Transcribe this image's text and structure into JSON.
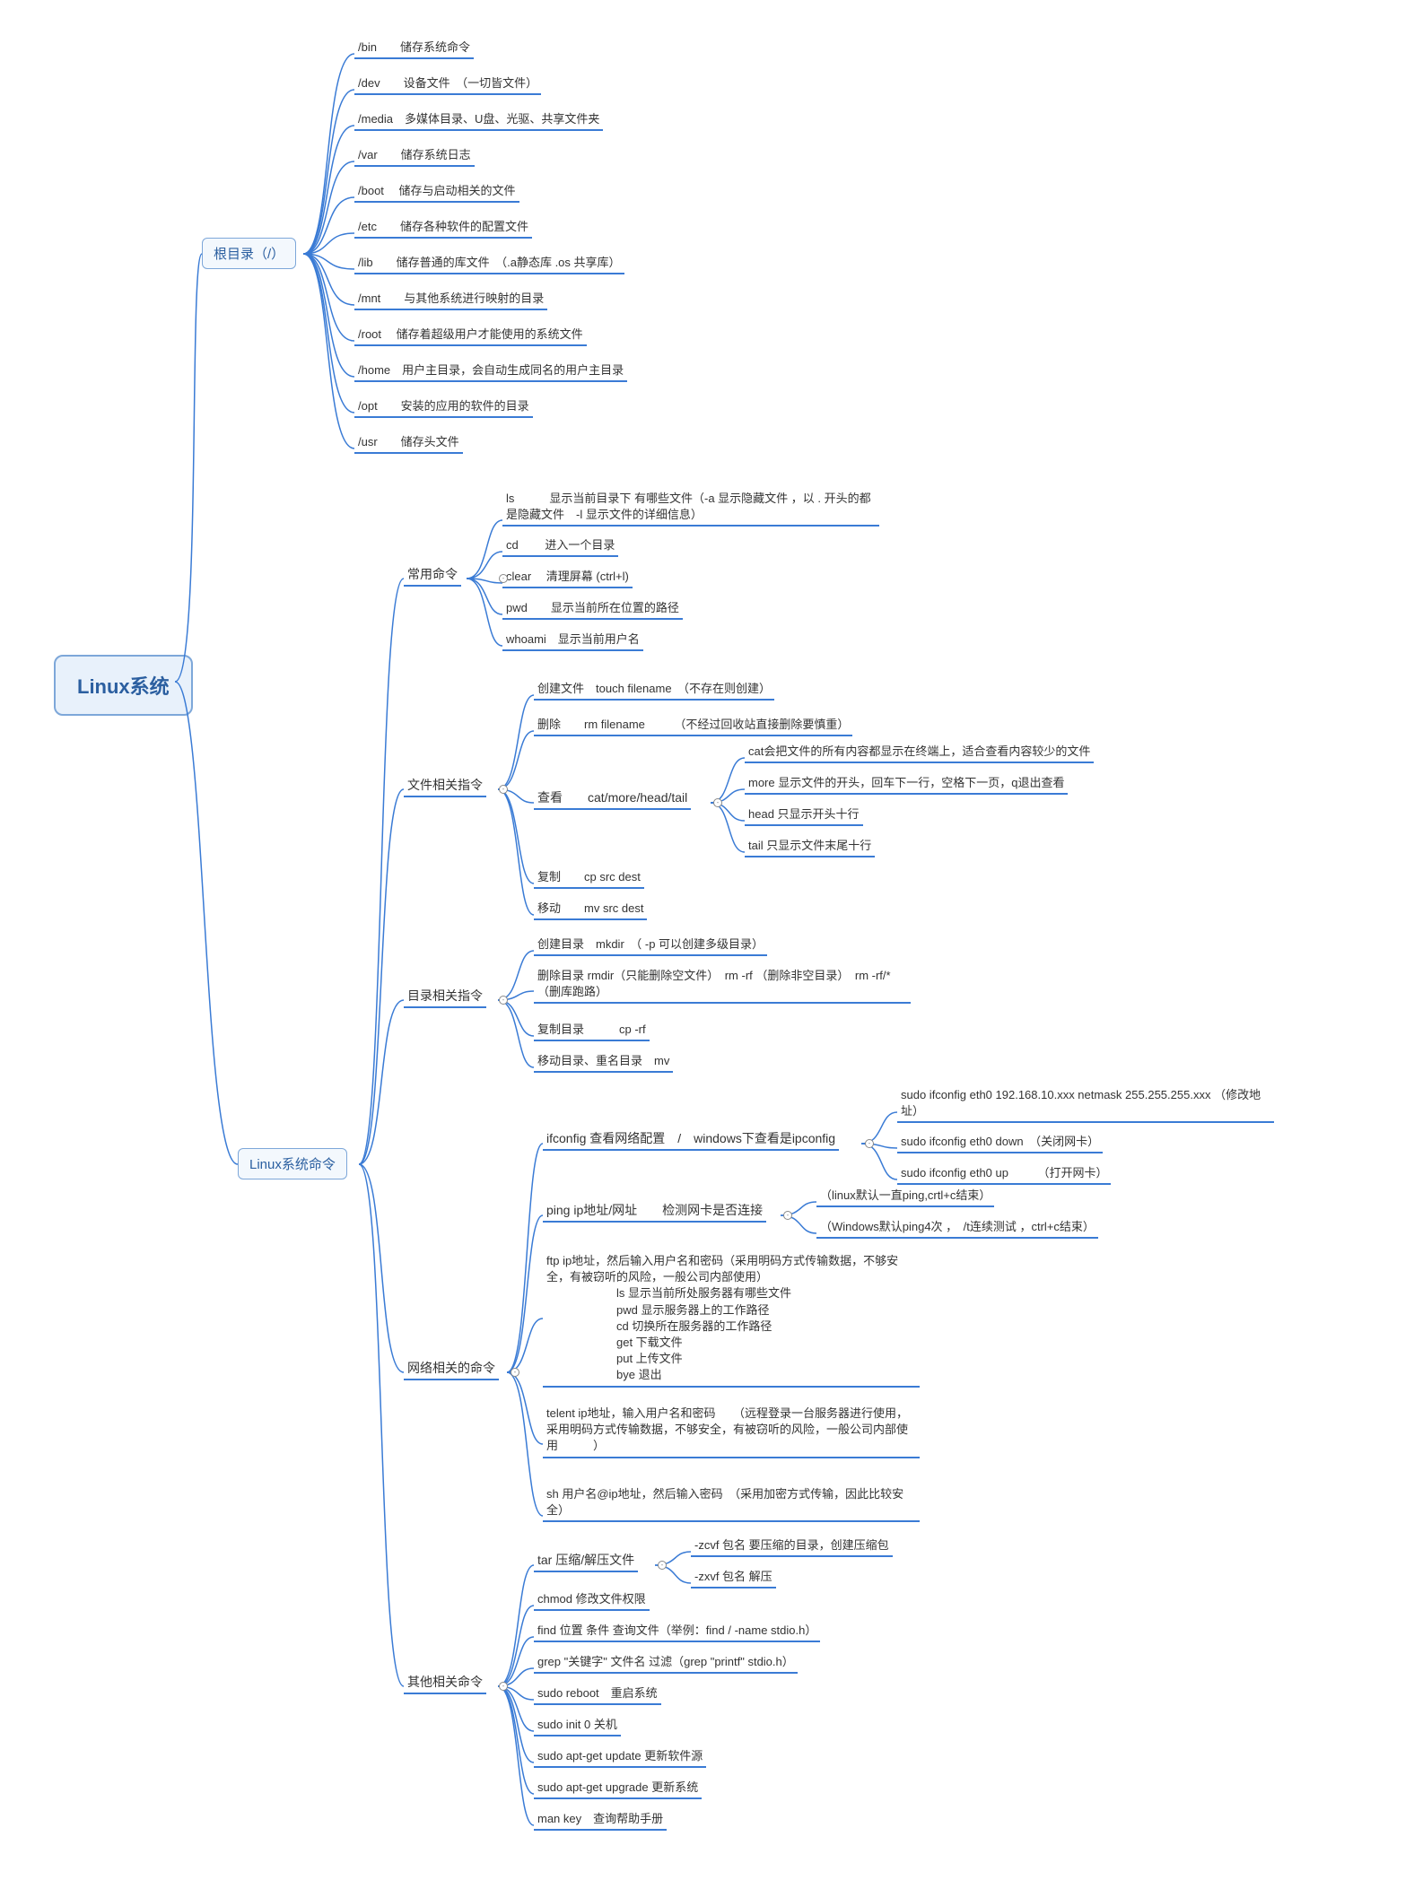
{
  "root": "Linux系统",
  "branch1": {
    "label": "根目录（/）",
    "items": [
      "/bin　　储存系统命令",
      "/dev　　设备文件　（一切皆文件）",
      "/media　多媒体目录、U盘、光驱、共享文件夹",
      "/var　　储存系统日志",
      "/boot　 储存与启动相关的文件",
      "/etc　　储存各种软件的配置文件",
      "/lib　　储存普通的库文件　（.a静态库 .os 共享库）",
      "/mnt　　与其他系统进行映射的目录",
      "/root　 储存着超级用户才能使用的系统文件",
      "/home　用户主目录，会自动生成同名的用户主目录",
      "/opt　　安装的应用的软件的目录",
      "/usr　　储存头文件"
    ]
  },
  "branch2": {
    "label": "Linux系统命令",
    "b2a": {
      "label": "常用命令",
      "items": [
        "ls　　　显示当前目录下 有哪些文件（-a 显示隐藏文件 ，以 . 开头的都是隐藏文件　-l 显示文件的详细信息）",
        "cd　　 进入一个目录",
        "clear　 清理屏幕 (ctrl+l)",
        "pwd　　显示当前所在位置的路径",
        "whoami　显示当前用户名"
      ]
    },
    "b2b": {
      "label": "文件相关指令",
      "items": [
        "创建文件　touch filename　（不存在则创建）",
        "删除　　rm filename　　　（不经过回收站直接删除要慎重）"
      ],
      "view": {
        "label": "查看　　cat/more/head/tail",
        "items": [
          "cat会把文件的所有内容都显示在终端上，适合查看内容较少的文件",
          "more 显示文件的开头，回车下一行，空格下一页，q退出查看",
          "head 只显示开头十行",
          "tail 只显示文件末尾十行"
        ]
      },
      "tail_items": [
        "复制　　cp src dest",
        "移动　　mv src dest"
      ]
    },
    "b2c": {
      "label": "目录相关指令",
      "items": [
        "创建目录　mkdir　（ -p 可以创建多级目录）",
        "删除目录 rmdir（只能删除空文件）　rm -rf （删除非空目录）　rm -rf/*（删库跑路）",
        "复制目录　　　cp -rf",
        "移动目录、重名目录　mv"
      ]
    },
    "b2d": {
      "label": "网络相关的命令",
      "ifc": {
        "label": "ifconfig 查看网络配置　/　windows下查看是ipconfig",
        "items": [
          "sudo ifconfig eth0 192.168.10.xxx netmask 255.255.255.xxx （修改地址）",
          "sudo ifconfig eth0 down　（关闭网卡）",
          "sudo ifconfig eth0 up　　　（打开网卡）"
        ]
      },
      "ping": {
        "label": "ping ip地址/网址　　检测网卡是否连接",
        "items": [
          "（linux默认一直ping,crtl+c结束）",
          "（Windows默认ping4次 ，　/t连续测试 ，ctrl+c结束）"
        ]
      },
      "items": [
        "ftp ip地址，然后输入用户名和密码（采用明码方式传输数据，不够安全，有被窃听的风险，一般公司内部使用）\n　　　　　　ls 显示当前所处服务器有哪些文件\n　　　　　　pwd 显示服务器上的工作路径\n　　　　　　cd 切换所在服务器的工作路径\n　　　　　　get 下载文件\n　　　　　　put 上传文件\n　　　　　　bye 退出",
        "telent ip地址，输入用户名和密码　　（远程登录一台服务器进行使用，采用明码方式传输数据，不够安全，有被窃听的风险，一般公司内部使用　　　）",
        "sh 用户名@ip地址，然后输入密码　（采用加密方式传输，因此比较安全）"
      ]
    },
    "b2e": {
      "label": "其他相关命令",
      "tar": {
        "label": "tar 压缩/解压文件",
        "items": [
          "-zcvf 包名 要压缩的目录，创建压缩包",
          "-zxvf 包名 解压"
        ]
      },
      "items": [
        "chmod 修改文件权限",
        "find 位置 条件 查询文件（举例：find / -name stdio.h）",
        "grep \"关键字\" 文件名 过滤（grep \"printf\" stdio.h）",
        "sudo reboot　重启系统",
        "sudo init 0 关机",
        "sudo apt-get update 更新软件源",
        "sudo apt-get upgrade 更新系统",
        "man key　查询帮助手册"
      ]
    }
  }
}
